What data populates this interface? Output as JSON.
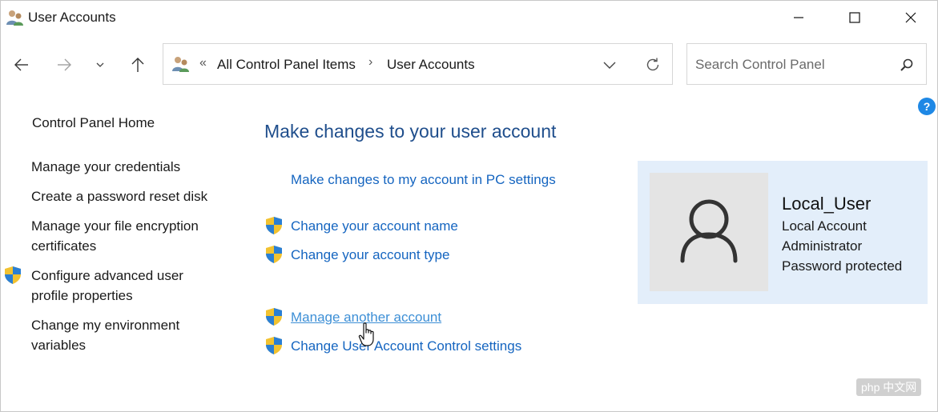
{
  "window": {
    "title": "User Accounts"
  },
  "address": {
    "overflow_glyph": "«",
    "crumbs": [
      "All Control Panel Items",
      "User Accounts"
    ],
    "separator": "›"
  },
  "search": {
    "placeholder": "Search Control Panel"
  },
  "help": {
    "label": "?"
  },
  "sidebar": {
    "home": "Control Panel Home",
    "items": [
      {
        "label": "Manage your credentials",
        "shield": false
      },
      {
        "label": "Create a password reset disk",
        "shield": false
      },
      {
        "label": "Manage your file encryption certificates",
        "shield": false
      },
      {
        "label": "Configure advanced user profile properties",
        "shield": true
      },
      {
        "label": "Change my environment variables",
        "shield": false
      }
    ]
  },
  "main": {
    "title": "Make changes to your user account",
    "links": [
      {
        "label": "Make changes to my account in PC settings",
        "shield": false
      },
      {
        "label": "Change your account name",
        "shield": true
      },
      {
        "label": "Change your account type",
        "shield": true
      },
      {
        "label": "Manage another account",
        "shield": true,
        "hovered": true
      },
      {
        "label": "Change User Account Control settings",
        "shield": true
      }
    ]
  },
  "account": {
    "name": "Local_User",
    "type": "Local Account",
    "role": "Administrator",
    "security": "Password protected"
  },
  "watermark": "php 中文网",
  "colors": {
    "link": "#1565c0",
    "title": "#1f4e8c",
    "card_bg": "#e3eefa",
    "help": "#1e88e5"
  },
  "icons": [
    "users-icon",
    "minimize-icon",
    "maximize-icon",
    "close-icon",
    "back-arrow-icon",
    "forward-arrow-icon",
    "chevron-down-icon",
    "up-arrow-icon",
    "refresh-icon",
    "search-icon",
    "help-icon",
    "uac-shield-icon",
    "user-avatar-icon",
    "hand-cursor-icon"
  ]
}
